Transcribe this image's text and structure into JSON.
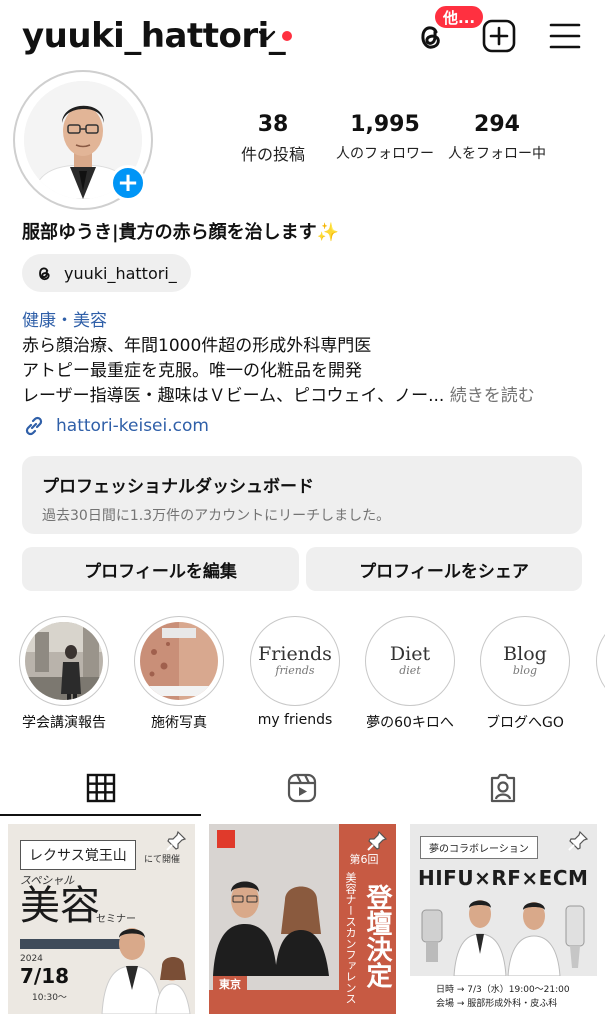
{
  "header": {
    "username": "yuuki_hattori_",
    "threads_badge": "他..."
  },
  "stats": {
    "posts_count": "38",
    "posts_label": "件の投稿",
    "followers_count": "1,995",
    "followers_label": "人のフォロワー",
    "following_count": "294",
    "following_label": "人をフォロー中"
  },
  "bio": {
    "display_name": "服部ゆうき|貴方の赤ら顔を治します✨",
    "threads_handle": "yuuki_hattori_",
    "category": "健康・美容",
    "line1": "赤ら顔治療、年間1000件超の形成外科専門医",
    "line2": "アトピー最重症を克服。唯一の化粧品を開発",
    "line3": "レーザー指導医・趣味はＶビーム、ピコウェイ、ノー...",
    "more": "続きを読む",
    "link": "hattori-keisei.com"
  },
  "dashboard": {
    "title": "プロフェッショナルダッシュボード",
    "subtitle": "過去30日間に1.3万件のアカウントにリーチしました。"
  },
  "buttons": {
    "edit_profile": "プロフィールを編集",
    "share_profile": "プロフィールをシェア"
  },
  "highlights": [
    {
      "label": "学会講演報告"
    },
    {
      "label": "施術写真"
    },
    {
      "label": "my friends",
      "cover_text": "Friends",
      "cover_sub": "friends"
    },
    {
      "label": "夢の60キロへ",
      "cover_text": "Diet",
      "cover_sub": "diet"
    },
    {
      "label": "ブログへGO",
      "cover_text": "Blog",
      "cover_sub": "blog"
    }
  ],
  "posts": [
    {
      "badge": "レクサス覚王山",
      "tag": "にて開催",
      "special": "スペシャル",
      "main": "美容",
      "seminar": "セミナー",
      "date": "7/18",
      "year": "2024",
      "time": "10:30〜"
    },
    {
      "vertical_title": "登壇決定",
      "vertical_sub": "美容ナースカンファレンス",
      "location": "東京",
      "round": "第6回"
    },
    {
      "heading": "夢のコラボレーション",
      "title": "HIFU×RF×ECM",
      "line1": "日時 → 7/3（水）19:00〜21:00",
      "line2": "会場 → 服部形成外科・皮ふ科"
    }
  ],
  "colors": {
    "accent_blue": "#0095f6",
    "link_blue": "#2f5fa8",
    "notification_red": "#ff3040",
    "post2_bg": "#c75a43"
  }
}
